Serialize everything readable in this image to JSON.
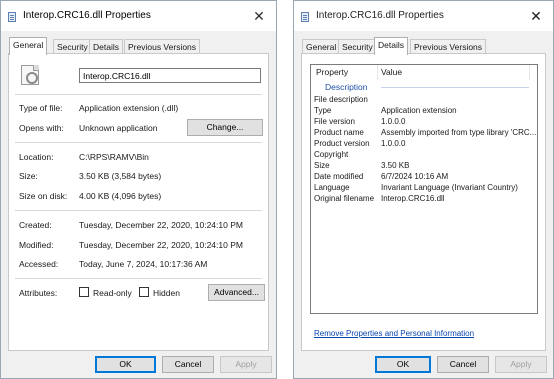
{
  "left_dialog": {
    "title": "Interop.CRC16.dll Properties",
    "close_glyph": "✕",
    "tabs": [
      {
        "label": "General"
      },
      {
        "label": "Security"
      },
      {
        "label": "Details"
      },
      {
        "label": "Previous Versions"
      }
    ],
    "file_name": "Interop.CRC16.dll",
    "type_label": "Type of file:",
    "type_value": "Application extension (.dll)",
    "opens_label": "Opens with:",
    "opens_value": "Unknown application",
    "change_button": "Change...",
    "location_label": "Location:",
    "location_value": "C:\\RPS\\RAMV\\Bin",
    "size_label": "Size:",
    "size_value": "3.50 KB (3,584 bytes)",
    "size_on_disk_label": "Size on disk:",
    "size_on_disk_value": "4.00 KB (4,096 bytes)",
    "created_label": "Created:",
    "created_value": "Tuesday, December 22, 2020, 10:24:10 PM",
    "modified_label": "Modified:",
    "modified_value": "Tuesday, December 22, 2020, 10:24:10 PM",
    "accessed_label": "Accessed:",
    "accessed_value": "Today, June 7, 2024, 10:17:36 AM",
    "attributes_label": "Attributes:",
    "readonly_label": "Read-only",
    "hidden_label": "Hidden",
    "advanced_button": "Advanced...",
    "ok_button": "OK",
    "cancel_button": "Cancel",
    "apply_button": "Apply"
  },
  "right_dialog": {
    "title": "Interop.CRC16.dll Properties",
    "close_glyph": "✕",
    "tabs": [
      {
        "label": "General"
      },
      {
        "label": "Security"
      },
      {
        "label": "Details"
      },
      {
        "label": "Previous Versions"
      }
    ],
    "list_header": {
      "property": "Property",
      "value": "Value"
    },
    "group_label": "Description",
    "properties": [
      {
        "name": "File description",
        "value": ""
      },
      {
        "name": "Type",
        "value": "Application extension"
      },
      {
        "name": "File version",
        "value": "1.0.0.0"
      },
      {
        "name": "Product name",
        "value": "Assembly imported from type library 'CRC..."
      },
      {
        "name": "Product version",
        "value": "1.0.0.0"
      },
      {
        "name": "Copyright",
        "value": ""
      },
      {
        "name": "Size",
        "value": "3.50 KB"
      },
      {
        "name": "Date modified",
        "value": "6/7/2024 10:16 AM"
      },
      {
        "name": "Language",
        "value": "Invariant Language (Invariant Country)"
      },
      {
        "name": "Original filename",
        "value": "Interop.CRC16.dll"
      }
    ],
    "remove_link": "Remove Properties and Personal Information",
    "ok_button": "OK",
    "cancel_button": "Cancel",
    "apply_button": "Apply"
  },
  "colors": {
    "accent": "#0078d7",
    "group_text": "#1f4fa8",
    "link": "#0645ad"
  }
}
